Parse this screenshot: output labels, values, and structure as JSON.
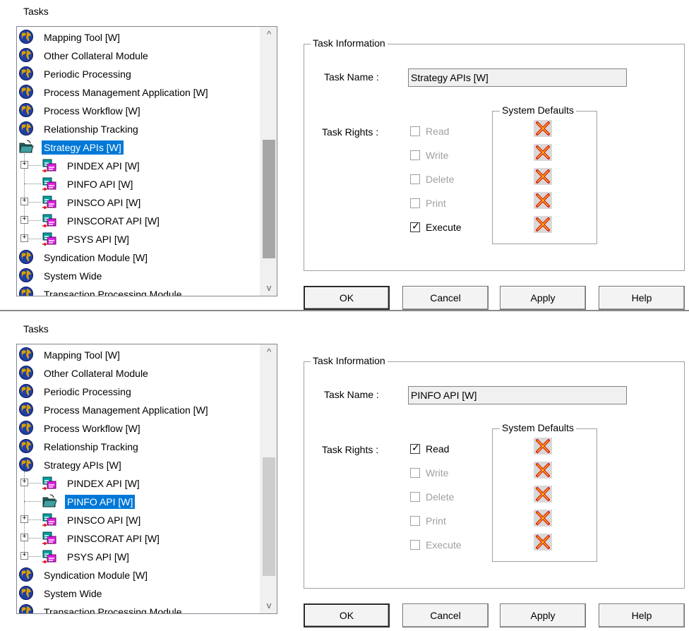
{
  "panels": [
    {
      "tasks_header": "Tasks",
      "tree_items": [
        {
          "label": "Mapping Tool [W]",
          "icon": "globe-icon",
          "level": 0
        },
        {
          "label": "Other Collateral Module",
          "icon": "globe-icon",
          "level": 0
        },
        {
          "label": "Periodic Processing",
          "icon": "globe-icon",
          "level": 0
        },
        {
          "label": "Process Management Application [W]",
          "icon": "globe-icon",
          "level": 0
        },
        {
          "label": "Process Workflow [W]",
          "icon": "globe-icon",
          "level": 0
        },
        {
          "label": "Relationship Tracking",
          "icon": "globe-icon",
          "level": 0
        },
        {
          "label": "Strategy APIs [W]",
          "icon": "folder-open-icon",
          "level": 0,
          "selected": true
        },
        {
          "label": "PINDEX API [W]",
          "icon": "api-icon",
          "level": 1,
          "expander": "+"
        },
        {
          "label": "PINFO API [W]",
          "icon": "api-icon",
          "level": 1
        },
        {
          "label": "PINSCO API [W]",
          "icon": "api-icon",
          "level": 1,
          "expander": "+"
        },
        {
          "label": "PINSCORAT API [W]",
          "icon": "api-icon",
          "level": 1,
          "expander": "+"
        },
        {
          "label": "PSYS API [W]",
          "icon": "api-icon",
          "level": 1,
          "expander": "+"
        },
        {
          "label": "Syndication Module [W]",
          "icon": "globe-icon",
          "level": 0
        },
        {
          "label": "System Wide",
          "icon": "globe-icon",
          "level": 0
        },
        {
          "label": "Transaction Processing Module",
          "icon": "globe-icon",
          "level": 0
        }
      ],
      "scroll_up": "^",
      "scroll_down": "v",
      "task_info": {
        "title": "Task Information",
        "task_name_label": "Task Name :",
        "task_name_value": "Strategy APIs [W]",
        "system_defaults_title": "System Defaults",
        "task_rights_label": "Task Rights :",
        "rights": [
          {
            "label": "Read",
            "checked": false,
            "enabled": false
          },
          {
            "label": "Write",
            "checked": false,
            "enabled": false
          },
          {
            "label": "Delete",
            "checked": false,
            "enabled": false
          },
          {
            "label": "Print",
            "checked": false,
            "enabled": false
          },
          {
            "label": "Execute",
            "checked": true,
            "enabled": true
          }
        ]
      },
      "buttons": {
        "ok": "OK",
        "cancel": "Cancel",
        "apply": "Apply",
        "help": "Help"
      }
    },
    {
      "tasks_header": "Tasks",
      "tree_items": [
        {
          "label": "Mapping Tool [W]",
          "icon": "globe-icon",
          "level": 0
        },
        {
          "label": "Other Collateral Module",
          "icon": "globe-icon",
          "level": 0
        },
        {
          "label": "Periodic Processing",
          "icon": "globe-icon",
          "level": 0
        },
        {
          "label": "Process Management Application [W]",
          "icon": "globe-icon",
          "level": 0
        },
        {
          "label": "Process Workflow [W]",
          "icon": "globe-icon",
          "level": 0
        },
        {
          "label": "Relationship Tracking",
          "icon": "globe-icon",
          "level": 0
        },
        {
          "label": "Strategy APIs [W]",
          "icon": "globe-icon",
          "level": 0
        },
        {
          "label": "PINDEX API [W]",
          "icon": "api-icon",
          "level": 1,
          "expander": "+"
        },
        {
          "label": "PINFO API [W]",
          "icon": "folder-open-icon",
          "level": 1,
          "selected": true
        },
        {
          "label": "PINSCO API [W]",
          "icon": "api-icon",
          "level": 1,
          "expander": "+"
        },
        {
          "label": "PINSCORAT API [W]",
          "icon": "api-icon",
          "level": 1,
          "expander": "+"
        },
        {
          "label": "PSYS API [W]",
          "icon": "api-icon",
          "level": 1,
          "expander": "+"
        },
        {
          "label": "Syndication Module [W]",
          "icon": "globe-icon",
          "level": 0
        },
        {
          "label": "System Wide",
          "icon": "globe-icon",
          "level": 0
        },
        {
          "label": "Transaction Processing Module",
          "icon": "globe-icon",
          "level": 0
        }
      ],
      "scroll_up": "^",
      "scroll_down": "v",
      "task_info": {
        "title": "Task Information",
        "task_name_label": "Task Name :",
        "task_name_value": "PINFO API [W]",
        "system_defaults_title": "System Defaults",
        "task_rights_label": "Task Rights :",
        "rights": [
          {
            "label": "Read",
            "checked": true,
            "enabled": true
          },
          {
            "label": "Write",
            "checked": false,
            "enabled": false
          },
          {
            "label": "Delete",
            "checked": false,
            "enabled": false
          },
          {
            "label": "Print",
            "checked": false,
            "enabled": false
          },
          {
            "label": "Execute",
            "checked": false,
            "enabled": false
          }
        ]
      },
      "buttons": {
        "ok": "OK",
        "cancel": "Cancel",
        "apply": "Apply",
        "help": "Help"
      }
    }
  ],
  "colors": {
    "selection": "#0078d7",
    "disabled_text": "#a0a0a0",
    "x_icon_red": "#e02020",
    "x_icon_yellow": "#f5d000"
  }
}
